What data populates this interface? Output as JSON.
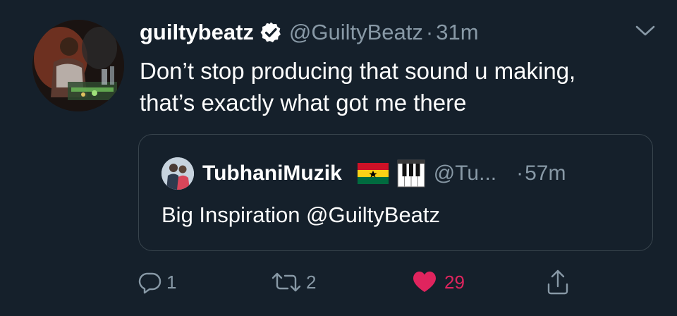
{
  "tweet": {
    "display_name": "guiltybeatz",
    "handle": "@GuiltyBeatz",
    "separator": "·",
    "time": "31m",
    "text_line1": "Don’t stop producing that sound u making,",
    "text_line2": "that’s exactly what got me there"
  },
  "quote": {
    "display_name": "TubhaniMuzik",
    "handle": "@Tu...",
    "separator": "·",
    "time": "57m",
    "text": "Big Inspiration @GuiltyBeatz"
  },
  "actions": {
    "reply_count": "1",
    "retweet_count": "2",
    "like_count": "29"
  },
  "colors": {
    "background": "#15202b",
    "secondary_text": "#8899a6",
    "border": "#38444d",
    "like": "#e0245e"
  },
  "icons": {
    "verified": "verified-badge-icon",
    "caret": "chevron-down-icon",
    "reply": "reply-icon",
    "retweet": "retweet-icon",
    "like": "heart-icon",
    "share": "share-icon",
    "flag": "ghana-flag-emoji",
    "piano": "piano-keys-emoji"
  }
}
